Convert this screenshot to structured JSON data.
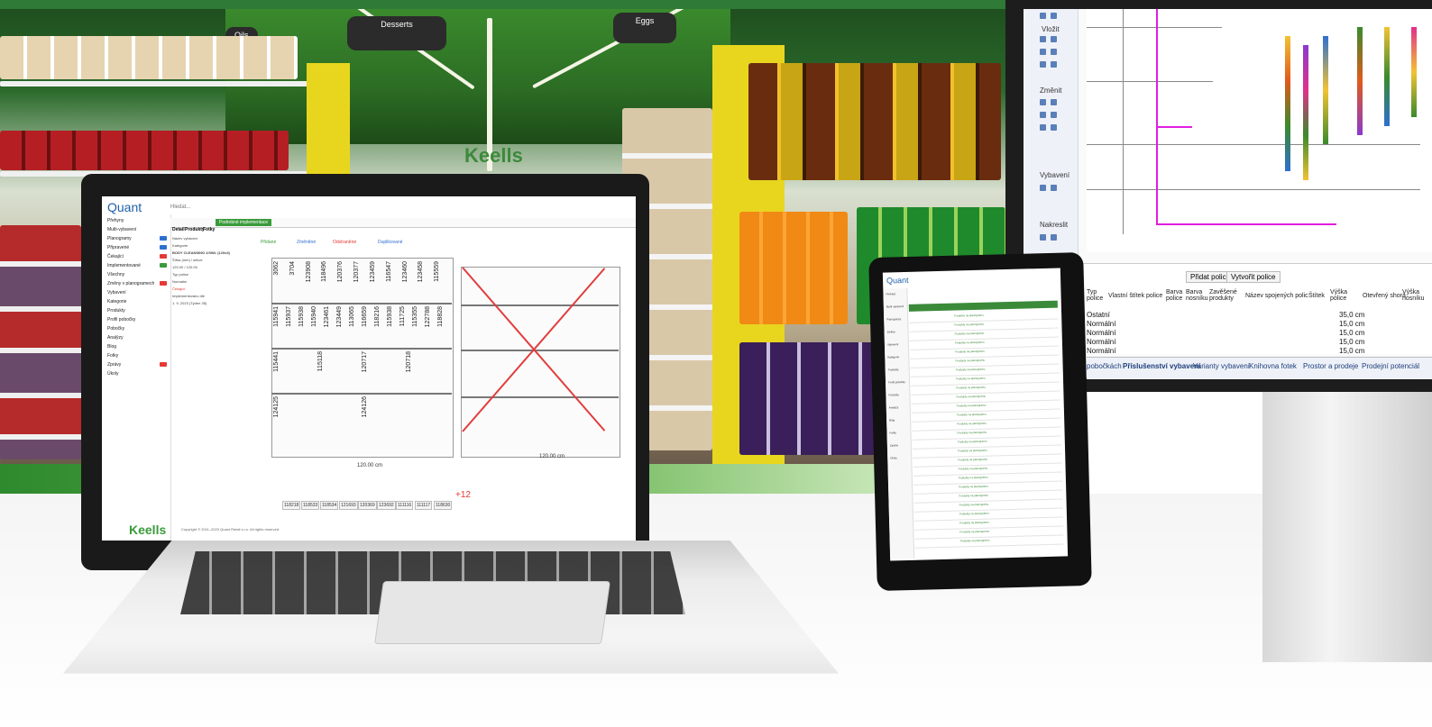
{
  "signs": {
    "desserts": "Desserts",
    "eggs": "Eggs",
    "oils": "Oils"
  },
  "store_logo": "Keells",
  "laptop": {
    "app_logo": "Quant",
    "search_placeholder": "Hledat...",
    "green_button": "Podrobné implementace",
    "tabs": [
      "Detail",
      "Produkty",
      "Fotky"
    ],
    "nav": [
      {
        "label": "Přehyny"
      },
      {
        "label": "Multi-vybavení"
      },
      {
        "label": "Planogramy",
        "badge": "#2f6fd0"
      },
      {
        "label": "Připravené",
        "badge": "#2f6fd0"
      },
      {
        "label": "Čekající",
        "badge": "#e53935"
      },
      {
        "label": "Implementované",
        "badge": "#3a9b3a"
      },
      {
        "label": "Všechny"
      },
      {
        "label": "Změny v planogramech",
        "badge": "#e53935"
      },
      {
        "label": "Vybavení"
      },
      {
        "label": "Kategorie"
      },
      {
        "label": "Produkty"
      },
      {
        "label": "Profil pobočky"
      },
      {
        "label": "Pobočky"
      },
      {
        "label": "Analýzy"
      },
      {
        "label": "Blog"
      },
      {
        "label": "Fotky"
      },
      {
        "label": "Zprávy",
        "badge": "#e53935"
      },
      {
        "label": "Úkoly"
      }
    ],
    "info": [
      "Název vybavení",
      "Kategorie",
      "BODY CLEANSING 2/3WL (120x3)",
      "Šířka (mm) / sekce",
      "120.00 / 120.00",
      "Typ police",
      "Normální",
      "Čekající",
      "Implementováno dle",
      "1. 9. 2023 (Týden 35)"
    ],
    "actions": [
      "Přidané",
      "Změněné",
      "Odstraněné",
      "Duplikované"
    ],
    "plano_left": {
      "row1": [
        "3062",
        "3704",
        "123908",
        "118496",
        "120376",
        "120377",
        "123459",
        "116547",
        "123460",
        "123458",
        "115559"
      ],
      "row2": [
        "115941",
        "115937",
        "115938",
        "115940",
        "123461",
        "123449",
        "113065",
        "116659",
        "118216",
        "115938",
        "111725",
        "115355",
        "122788",
        "118828"
      ],
      "row3": [
        "115441",
        "115118",
        "120717",
        "120718"
      ],
      "row4": [
        "124125",
        "124126"
      ],
      "width": "120.00 cm"
    },
    "plano_right_width": "120.00 cm",
    "bottom_products": [
      "118218",
      "118533",
      "118534",
      "121693",
      "120369",
      "123692",
      "111116",
      "111117",
      "118630"
    ],
    "more_count": "+12",
    "footer_brand": "Keells",
    "copyright": "Copyright © 2011–2023 Quant Retail s.r.o. All rights reserved."
  },
  "monitor": {
    "toolbar_groups": [
      "Vložit",
      "Změnit",
      "Vybavení",
      "Nakreslit"
    ],
    "add_shelf": "Přidat polici",
    "create_shelf": "Vytvořit police",
    "columns": [
      "Typ police",
      "Vlastní štítek police",
      "Barva police",
      "Barva nosníku",
      "Zavěšené produkty",
      "Název spojených polic",
      "Štítek",
      "Výška police",
      "Otevřený shora",
      "Výška nosníku"
    ],
    "rows": [
      {
        "type": "Ostatní",
        "height": "35,0 cm"
      },
      {
        "type": "Normální",
        "height": "15,0 cm"
      },
      {
        "type": "Normální",
        "height": "15,0 cm"
      },
      {
        "type": "Normální",
        "height": "15,0 cm"
      },
      {
        "type": "Normální",
        "height": "15,0 cm"
      }
    ],
    "tabs": [
      "pobočkách",
      "Příslušenství vybavení",
      "Varianty vybavení",
      "Knihovna fotek",
      "Prostor a prodeje",
      "Prodejní potenciál"
    ]
  },
  "tablet": {
    "app_logo": "Quant",
    "side": [
      "Přehled",
      "Multi-vybavení",
      "Planogramy",
      "Změny",
      "Vybavení",
      "Kategorie",
      "Produkty",
      "Profil pobočky",
      "Pobočky",
      "Analýzy",
      "Blog",
      "Fotky",
      "Zprávy",
      "Úkoly"
    ],
    "row_text": "Produkty na planogramu"
  }
}
